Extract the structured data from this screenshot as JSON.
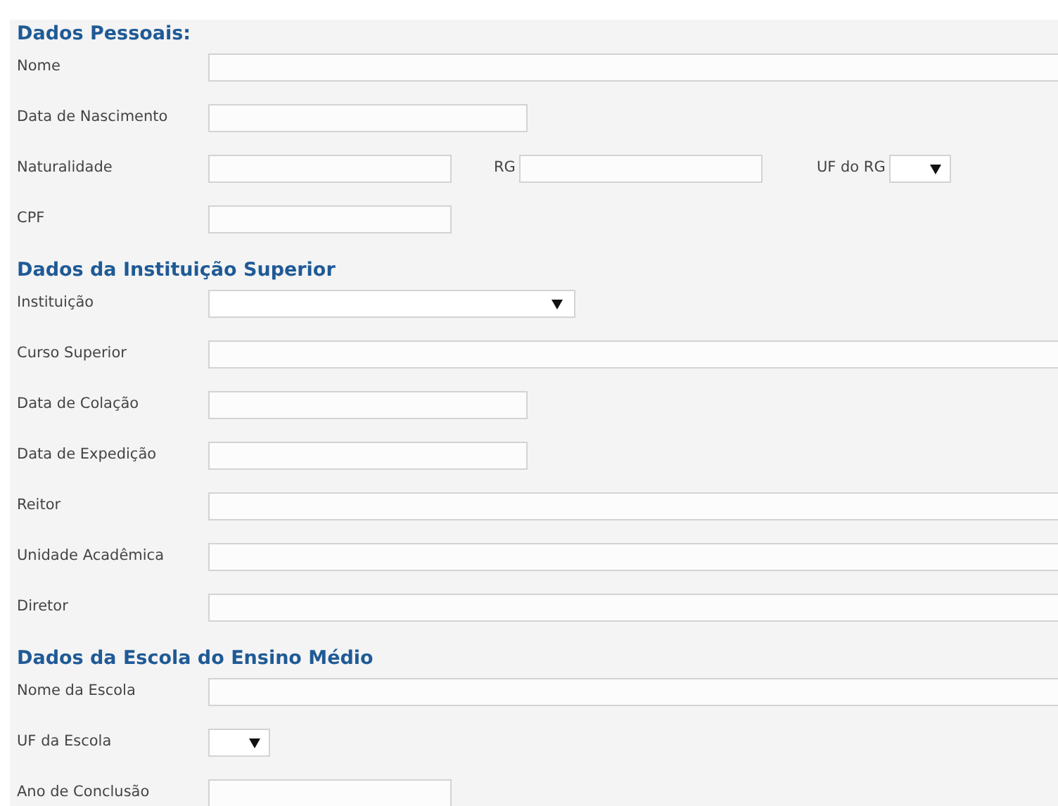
{
  "sections": [
    {
      "title": "Dados Pessoais:",
      "fields": [
        {
          "label": "Nome",
          "kind": "wide"
        },
        {
          "label": "Data de Nascimento",
          "kind": "medium"
        },
        {
          "label": "Naturalidade",
          "kind": "short",
          "extras": [
            {
              "label": "RG",
              "kind": "short"
            },
            {
              "label": "UF do RG",
              "kind": "tinyselect"
            }
          ]
        },
        {
          "label": "CPF",
          "kind": "short"
        }
      ]
    },
    {
      "title": "Dados da Instituição Superior",
      "fields": [
        {
          "label": "Instituição",
          "kind": "select"
        },
        {
          "label": "Curso Superior",
          "kind": "wide"
        },
        {
          "label": "Data de Colação",
          "kind": "medium"
        },
        {
          "label": "Data de Expedição",
          "kind": "medium"
        },
        {
          "label": "Reitor",
          "kind": "wide"
        },
        {
          "label": "Unidade Acadêmica",
          "kind": "wide"
        },
        {
          "label": "Diretor",
          "kind": "wide"
        }
      ]
    },
    {
      "title": "Dados da Escola do Ensino Médio",
      "fields": [
        {
          "label": "Nome da Escola",
          "kind": "wide"
        },
        {
          "label": "UF da Escola",
          "kind": "tinyselect"
        },
        {
          "label": "Ano de Conclusão",
          "kind": "short"
        }
      ]
    }
  ]
}
